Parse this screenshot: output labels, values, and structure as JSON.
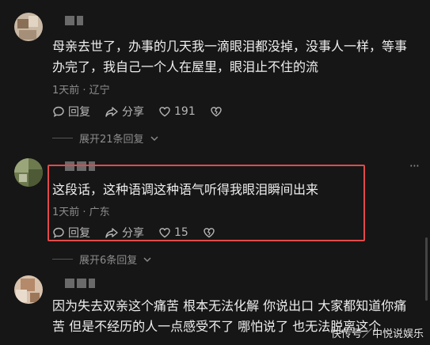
{
  "comments": [
    {
      "text": "母亲去世了，办事的几天我一滴眼泪都没掉，没事人一样，等事办完了，我自己一个人在屋里，眼泪止不住的流",
      "meta": "1天前 · 辽宁",
      "reply_label": "回复",
      "share_label": "分享",
      "like_count": "191",
      "expand_label": "展开21条回复"
    },
    {
      "text": "这段话，这种语调这种语气听得我眼泪瞬间出来",
      "meta": "1天前 · 广东",
      "reply_label": "回复",
      "share_label": "分享",
      "like_count": "15",
      "expand_label": "展开6条回复",
      "highlighted": true,
      "highlight_color": "#e24a4a"
    },
    {
      "text": "因为失去双亲这个痛苦 根本无法化解 你说出口 大家都知道你痛苦 但是不经历的人一点感受不了 哪怕说了 也无法脱离这个"
    }
  ],
  "watermark": "快传号／中悦说娱乐",
  "icons": [
    "comment-icon",
    "share-icon",
    "heart-icon",
    "broken-heart-icon",
    "chevron-down-icon",
    "more-icon"
  ]
}
